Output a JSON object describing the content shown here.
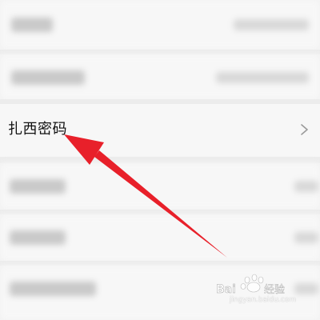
{
  "settings": {
    "highlighted_item_label": "扎西密码",
    "chevron_icon": "chevron-right-icon"
  },
  "watermark": {
    "brand_text": "Bai",
    "brand_suffix": "经验",
    "url": "jingyan.baidu.com"
  },
  "colors": {
    "background": "#f2f2f2",
    "row_background": "#f7f7f7",
    "arrow": "#e8202a"
  }
}
